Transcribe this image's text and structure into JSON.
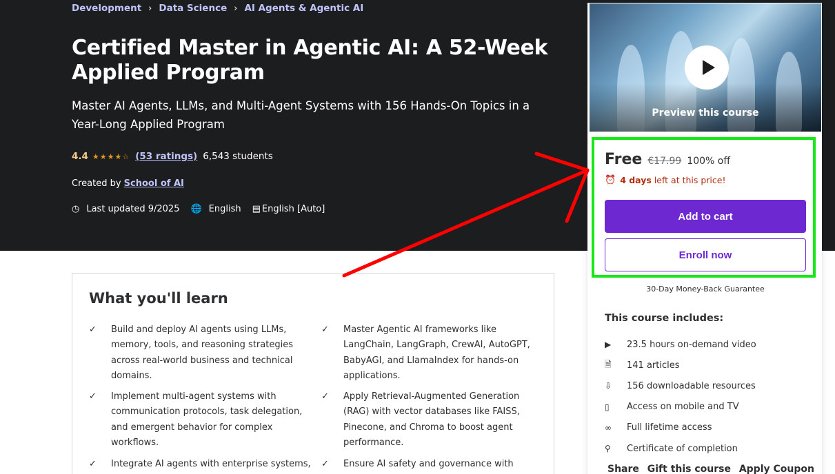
{
  "breadcrumb": [
    "Development",
    "Data Science",
    "AI Agents & Agentic AI"
  ],
  "course": {
    "title": "Certified Master in Agentic AI: A 52-Week Applied Program",
    "subtitle": "Master AI Agents, LLMs, and Multi-Agent Systems with 156 Hands-On Topics in a Year-Long Applied Program",
    "rating": "4.4",
    "ratings_count": "(53 ratings)",
    "students": "6,543 students",
    "created_by_label": "Created by",
    "instructor": "School of AI",
    "last_updated": "Last updated 9/2025",
    "language": "English",
    "captions": "English [Auto]"
  },
  "learn": {
    "title": "What you'll learn",
    "items": [
      "Build and deploy AI agents using LLMs, memory, tools, and reasoning strategies across real-world business and technical domains.",
      "Master Agentic AI frameworks like LangChain, LangGraph, CrewAI, AutoGPT, BabyAGI, and LlamaIndex for hands-on applications.",
      "Implement multi-agent systems with communication protocols, task delegation, and emergent behavior for complex workflows.",
      "Apply Retrieval-Augmented Generation (RAG) with vector databases like FAISS, Pinecone, and Chroma to boost agent performance.",
      "Integrate AI agents with enterprise systems,",
      "Ensure AI safety and governance with"
    ]
  },
  "card": {
    "preview_label": "Preview this course",
    "price": "Free",
    "original_price": "€17.99",
    "discount": "100% off",
    "timer_bold": "4 days",
    "timer_rest": "left at this price!",
    "add_to_cart": "Add to cart",
    "enroll_now": "Enroll now",
    "guarantee": "30-Day Money-Back Guarantee",
    "includes_title": "This course includes:",
    "includes": [
      {
        "icon": "video-icon",
        "text": "23.5 hours on-demand video"
      },
      {
        "icon": "article-icon",
        "text": "141 articles"
      },
      {
        "icon": "download-icon",
        "text": "156 downloadable resources"
      },
      {
        "icon": "mobile-icon",
        "text": "Access on mobile and TV"
      },
      {
        "icon": "infinity-icon",
        "text": "Full lifetime access"
      },
      {
        "icon": "trophy-icon",
        "text": "Certificate of completion"
      }
    ],
    "actions": [
      "Share",
      "Gift this course",
      "Apply Coupon"
    ]
  },
  "colors": {
    "hero_bg": "#1c1d1f",
    "accent_purple": "#6d28d2",
    "link_lavender": "#c0c4fc",
    "rating_gold": "#f3ca8c",
    "highlight_green": "#18e818",
    "annotation_red": "#ff0000"
  }
}
